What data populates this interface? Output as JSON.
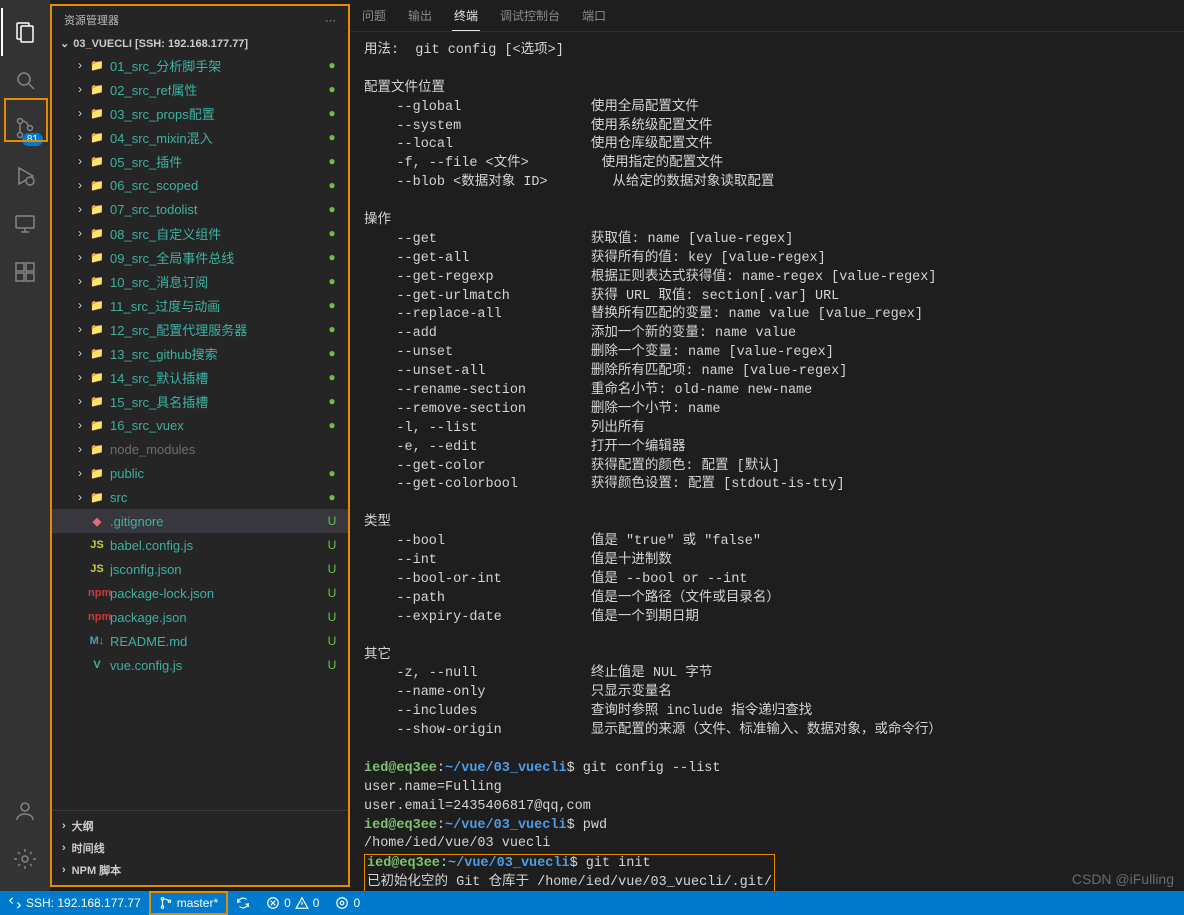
{
  "activityBar": {
    "scm_badge": "81"
  },
  "sidebar": {
    "title": "资源管理器",
    "project": "03_VUECLI [SSH: 192.168.177.77]",
    "items": [
      {
        "type": "folder",
        "label": "01_src_分析脚手架",
        "status": "dot"
      },
      {
        "type": "folder",
        "label": "02_src_ref属性",
        "status": "dot"
      },
      {
        "type": "folder",
        "label": "03_src_props配置",
        "status": "dot"
      },
      {
        "type": "folder",
        "label": "04_src_mixin混入",
        "status": "dot"
      },
      {
        "type": "folder",
        "label": "05_src_插件",
        "status": "dot"
      },
      {
        "type": "folder",
        "label": "06_src_scoped",
        "status": "dot"
      },
      {
        "type": "folder",
        "label": "07_src_todolist",
        "status": "dot"
      },
      {
        "type": "folder",
        "label": "08_src_自定义组件",
        "status": "dot"
      },
      {
        "type": "folder",
        "label": "09_src_全局事件总线",
        "status": "dot"
      },
      {
        "type": "folder",
        "label": "10_src_消息订阅",
        "status": "dot"
      },
      {
        "type": "folder",
        "label": "11_src_过度与动画",
        "status": "dot"
      },
      {
        "type": "folder",
        "label": "12_src_配置代理服务器",
        "status": "dot"
      },
      {
        "type": "folder",
        "label": "13_src_github搜索",
        "status": "dot"
      },
      {
        "type": "folder",
        "label": "14_src_默认插槽",
        "status": "dot"
      },
      {
        "type": "folder",
        "label": "15_src_具名插槽",
        "status": "dot"
      },
      {
        "type": "folder",
        "label": "16_src_vuex",
        "status": "dot"
      },
      {
        "type": "folder-muted",
        "label": "node_modules",
        "status": ""
      },
      {
        "type": "folder-green",
        "label": "public",
        "status": "dot"
      },
      {
        "type": "folder-red",
        "label": "src",
        "status": "dot"
      },
      {
        "type": "file-git",
        "label": ".gitignore",
        "status": "U",
        "selected": true
      },
      {
        "type": "file-js",
        "label": "babel.config.js",
        "status": "U"
      },
      {
        "type": "file-js2",
        "label": "jsconfig.json",
        "status": "U"
      },
      {
        "type": "file-npm",
        "label": "package-lock.json",
        "status": "U"
      },
      {
        "type": "file-npm",
        "label": "package.json",
        "status": "U"
      },
      {
        "type": "file-md",
        "label": "README.md",
        "status": "U"
      },
      {
        "type": "file-vue",
        "label": "vue.config.js",
        "status": "U"
      }
    ],
    "sections": {
      "outline": "大纲",
      "timeline": "时间线",
      "npm": "NPM 脚本"
    }
  },
  "panel": {
    "tabs": {
      "problems": "问题",
      "output": "输出",
      "terminal": "终端",
      "debug": "调试控制台",
      "ports": "端口"
    }
  },
  "terminal": {
    "usage": "用法:  git config [<选项>]",
    "sec1_title": "配置文件位置",
    "sec1": [
      {
        "opt": "--global",
        "desc": "使用全局配置文件"
      },
      {
        "opt": "--system",
        "desc": "使用系统级配置文件"
      },
      {
        "opt": "--local",
        "desc": "使用仓库级配置文件"
      },
      {
        "opt": "-f, --file <文件>",
        "desc": "使用指定的配置文件"
      },
      {
        "opt": "--blob <数据对象 ID>",
        "desc": "从给定的数据对象读取配置"
      }
    ],
    "sec2_title": "操作",
    "sec2": [
      {
        "opt": "--get",
        "desc": "获取值: name [value-regex]"
      },
      {
        "opt": "--get-all",
        "desc": "获得所有的值: key [value-regex]"
      },
      {
        "opt": "--get-regexp",
        "desc": "根据正则表达式获得值: name-regex [value-regex]"
      },
      {
        "opt": "--get-urlmatch",
        "desc": "获得 URL 取值: section[.var] URL"
      },
      {
        "opt": "--replace-all",
        "desc": "替换所有匹配的变量: name value [value_regex]"
      },
      {
        "opt": "--add",
        "desc": "添加一个新的变量: name value"
      },
      {
        "opt": "--unset",
        "desc": "删除一个变量: name [value-regex]"
      },
      {
        "opt": "--unset-all",
        "desc": "删除所有匹配项: name [value-regex]"
      },
      {
        "opt": "--rename-section",
        "desc": "重命名小节: old-name new-name"
      },
      {
        "opt": "--remove-section",
        "desc": "删除一个小节: name"
      },
      {
        "opt": "-l, --list",
        "desc": "列出所有"
      },
      {
        "opt": "-e, --edit",
        "desc": "打开一个编辑器"
      },
      {
        "opt": "--get-color",
        "desc": "获得配置的颜色: 配置 [默认]"
      },
      {
        "opt": "--get-colorbool",
        "desc": "获得颜色设置: 配置 [stdout-is-tty]"
      }
    ],
    "sec3_title": "类型",
    "sec3": [
      {
        "opt": "--bool",
        "desc": "值是 \"true\" 或 \"false\""
      },
      {
        "opt": "--int",
        "desc": "值是十进制数"
      },
      {
        "opt": "--bool-or-int",
        "desc": "值是 --bool or --int"
      },
      {
        "opt": "--path",
        "desc": "值是一个路径（文件或目录名）"
      },
      {
        "opt": "--expiry-date",
        "desc": "值是一个到期日期"
      }
    ],
    "sec4_title": "其它",
    "sec4": [
      {
        "opt": "-z, --null",
        "desc": "终止值是 NUL 字节"
      },
      {
        "opt": "--name-only",
        "desc": "只显示变量名"
      },
      {
        "opt": "--includes",
        "desc": "查询时参照 include 指令递归查找"
      },
      {
        "opt": "--show-origin",
        "desc": "显示配置的来源（文件、标准输入、数据对象，或命令行）"
      }
    ],
    "prompt_user": "ied@eq3ee",
    "prompt_path": "~/vue/03_vuecli",
    "cmd1": "git config --list",
    "out1a": "user.name=Fulling",
    "out1b": "user.email=2435406817@qq,com",
    "cmd2": "pwd",
    "out2": "/home/ied/vue/03 vuecli",
    "cmd3": "git init",
    "out3": "已初始化空的 Git 仓库于 /home/ied/vue/03_vuecli/.git/"
  },
  "statusbar": {
    "remote": "SSH: 192.168.177.77",
    "branch": "master*",
    "errors": "0",
    "warnings": "0",
    "ports": "0"
  },
  "watermark": "CSDN @iFulling"
}
